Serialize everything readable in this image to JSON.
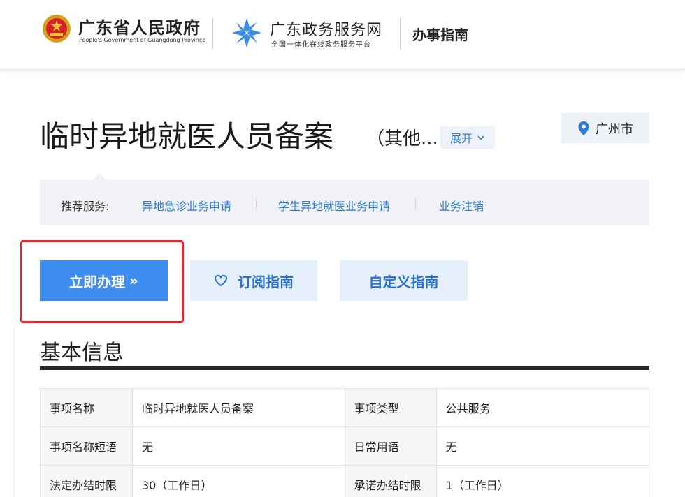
{
  "header": {
    "gov_name": "广东省人民政府",
    "gov_name_en": "People's Government of Guangdong Province",
    "portal_name": "广东政务服务网",
    "portal_sub": "全国一体化在线政务服务平台",
    "section": "办事指南"
  },
  "service": {
    "title": "临时异地就医人员备案",
    "subtitle": "（其他...",
    "expand_label": "展开",
    "city": "广州市"
  },
  "recommended": {
    "label": "推荐服务:",
    "links": [
      "异地急诊业务申请",
      "学生异地就医业务申请",
      "业务注销"
    ]
  },
  "actions": {
    "apply_label": "立即办理",
    "apply_arrow": "»",
    "subscribe_label": "订阅指南",
    "custom_label": "自定义指南"
  },
  "basic_info": {
    "title": "基本信息",
    "rows": [
      [
        "事项名称",
        "临时异地就医人员备案",
        "事项类型",
        "公共服务"
      ],
      [
        "事项名称短语",
        "无",
        "日常用语",
        "无"
      ],
      [
        "法定办结时限",
        "30（工作日）",
        "承诺办结时限",
        "1（工作日）"
      ]
    ]
  },
  "colors": {
    "primary": "#3d8ef0",
    "link": "#2b7bd6",
    "highlight_border": "#e8262c",
    "light_button": "#e6f0fd"
  },
  "icons": [
    "national-emblem-icon",
    "portal-logo-icon",
    "chevron-down-icon",
    "location-pin-icon",
    "heart-icon"
  ]
}
